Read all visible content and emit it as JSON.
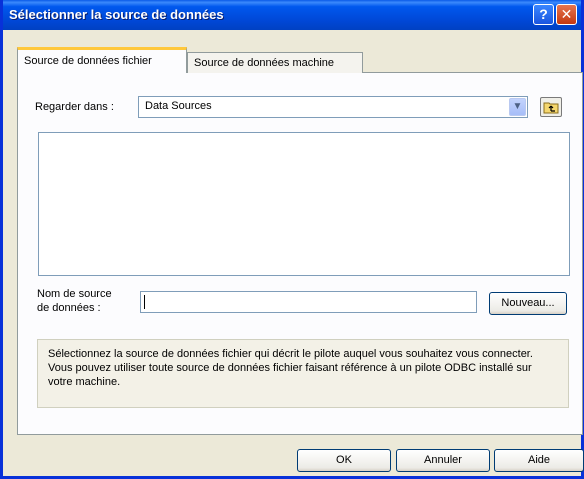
{
  "window": {
    "title": "Sélectionner la source de données",
    "help_button": "?",
    "close_button": "✕"
  },
  "tabs": [
    {
      "label": "Source de données fichier",
      "active": true
    },
    {
      "label": "Source de données machine",
      "active": false
    }
  ],
  "look_in": {
    "label": "Regarder dans :",
    "value": "Data Sources"
  },
  "dsn_name": {
    "label_line1": "Nom de source",
    "label_line2": "de données :",
    "value": "",
    "new_button": "Nouveau..."
  },
  "description": "Sélectionnez la source de données fichier qui décrit le pilote auquel vous souhaitez vous connecter. Vous pouvez utiliser toute source de données fichier faisant référence à un pilote ODBC installé sur votre machine.",
  "buttons": {
    "ok": "OK",
    "cancel": "Annuler",
    "help": "Aide"
  },
  "colors": {
    "title_bar": "#0054e3",
    "tab_highlight": "#ffc83c",
    "dialog_bg": "#ece9d8"
  }
}
